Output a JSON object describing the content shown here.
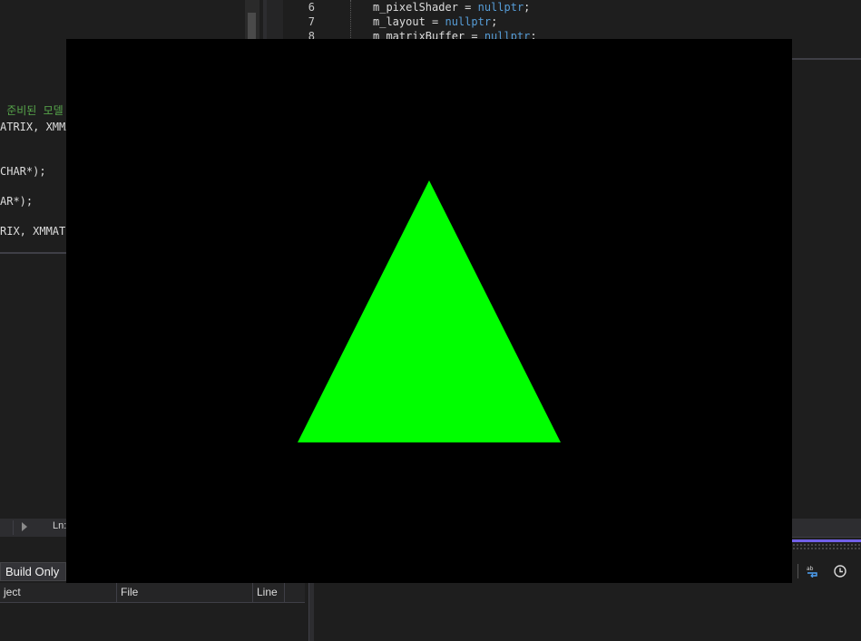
{
  "left_editor": {
    "lines": [
      {
        "pre": "",
        "comment": " 준비된 모델"
      },
      {
        "pre": "ATRIX, XMMA",
        "comment": ""
      },
      {
        "pre": "CHAR*);",
        "comment": ""
      },
      {
        "pre": "AR*);",
        "comment": ""
      },
      {
        "pre": "RIX, XMMATR",
        "comment": ""
      }
    ]
  },
  "right_editor": {
    "line_numbers": [
      "6",
      "7",
      "8"
    ],
    "lines": [
      {
        "text": "m_pixelShader = ",
        "keyword": "nullptr",
        "tail": ";"
      },
      {
        "text": "m_layout = ",
        "keyword": "nullptr",
        "tail": ";"
      },
      {
        "text": "m_matrixBuffer = ",
        "keyword": "nullptr",
        "tail": ";"
      }
    ]
  },
  "status_bar": {
    "ln_label": "Ln:"
  },
  "error_list": {
    "filter_value": "Build Only",
    "columns": [
      "ject",
      "File",
      "Line"
    ]
  },
  "toolbar": {
    "icons": [
      "word-wrap-icon",
      "history-icon"
    ]
  },
  "render_window": {
    "background": "#000000",
    "shape": "triangle",
    "shape_color": "#00ff00"
  },
  "colors": {
    "ide_background": "#1e1e1e",
    "comment": "#57a64a",
    "keyword": "#569cd6",
    "accent": "#7160e8"
  }
}
